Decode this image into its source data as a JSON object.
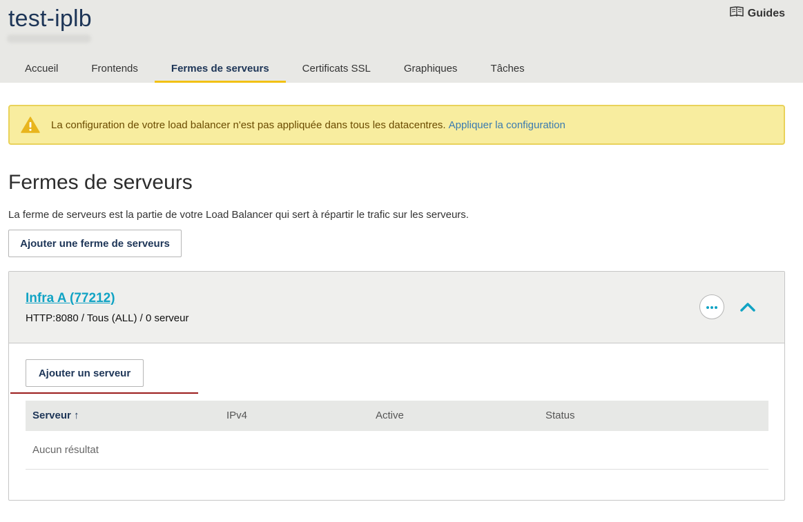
{
  "app": {
    "title": "test-iplb"
  },
  "guides": {
    "label": "Guides",
    "icon": "book-icon"
  },
  "tabs": [
    {
      "label": "Accueil"
    },
    {
      "label": "Frontends"
    },
    {
      "label": "Fermes de serveurs",
      "active": true
    },
    {
      "label": "Certificats SSL"
    },
    {
      "label": "Graphiques"
    },
    {
      "label": "Tâches"
    }
  ],
  "alert": {
    "icon": "warning-icon",
    "message": "La configuration de votre load balancer n'est pas appliquée dans tous les datacentres.",
    "link": "Appliquer la configuration"
  },
  "page": {
    "title": "Fermes de serveurs",
    "description": "La ferme de serveurs est la partie de votre Load Balancer qui sert à répartir le trafic sur les serveurs.",
    "add_farm_label": "Ajouter une ferme de serveurs"
  },
  "farm": {
    "name": "Infra A (77212)",
    "meta": "HTTP:8080 / Tous (ALL) / 0 serveur",
    "add_server_label": "Ajouter un serveur",
    "table": {
      "columns": [
        "Serveur ↑",
        "IPv4",
        "Active",
        "Status"
      ],
      "empty_text": "Aucun résultat"
    }
  },
  "colors": {
    "accent": "#f2c114",
    "link": "#11a3c4",
    "alert_bg": "#f8ed9f",
    "primary_text": "#1d3557"
  }
}
